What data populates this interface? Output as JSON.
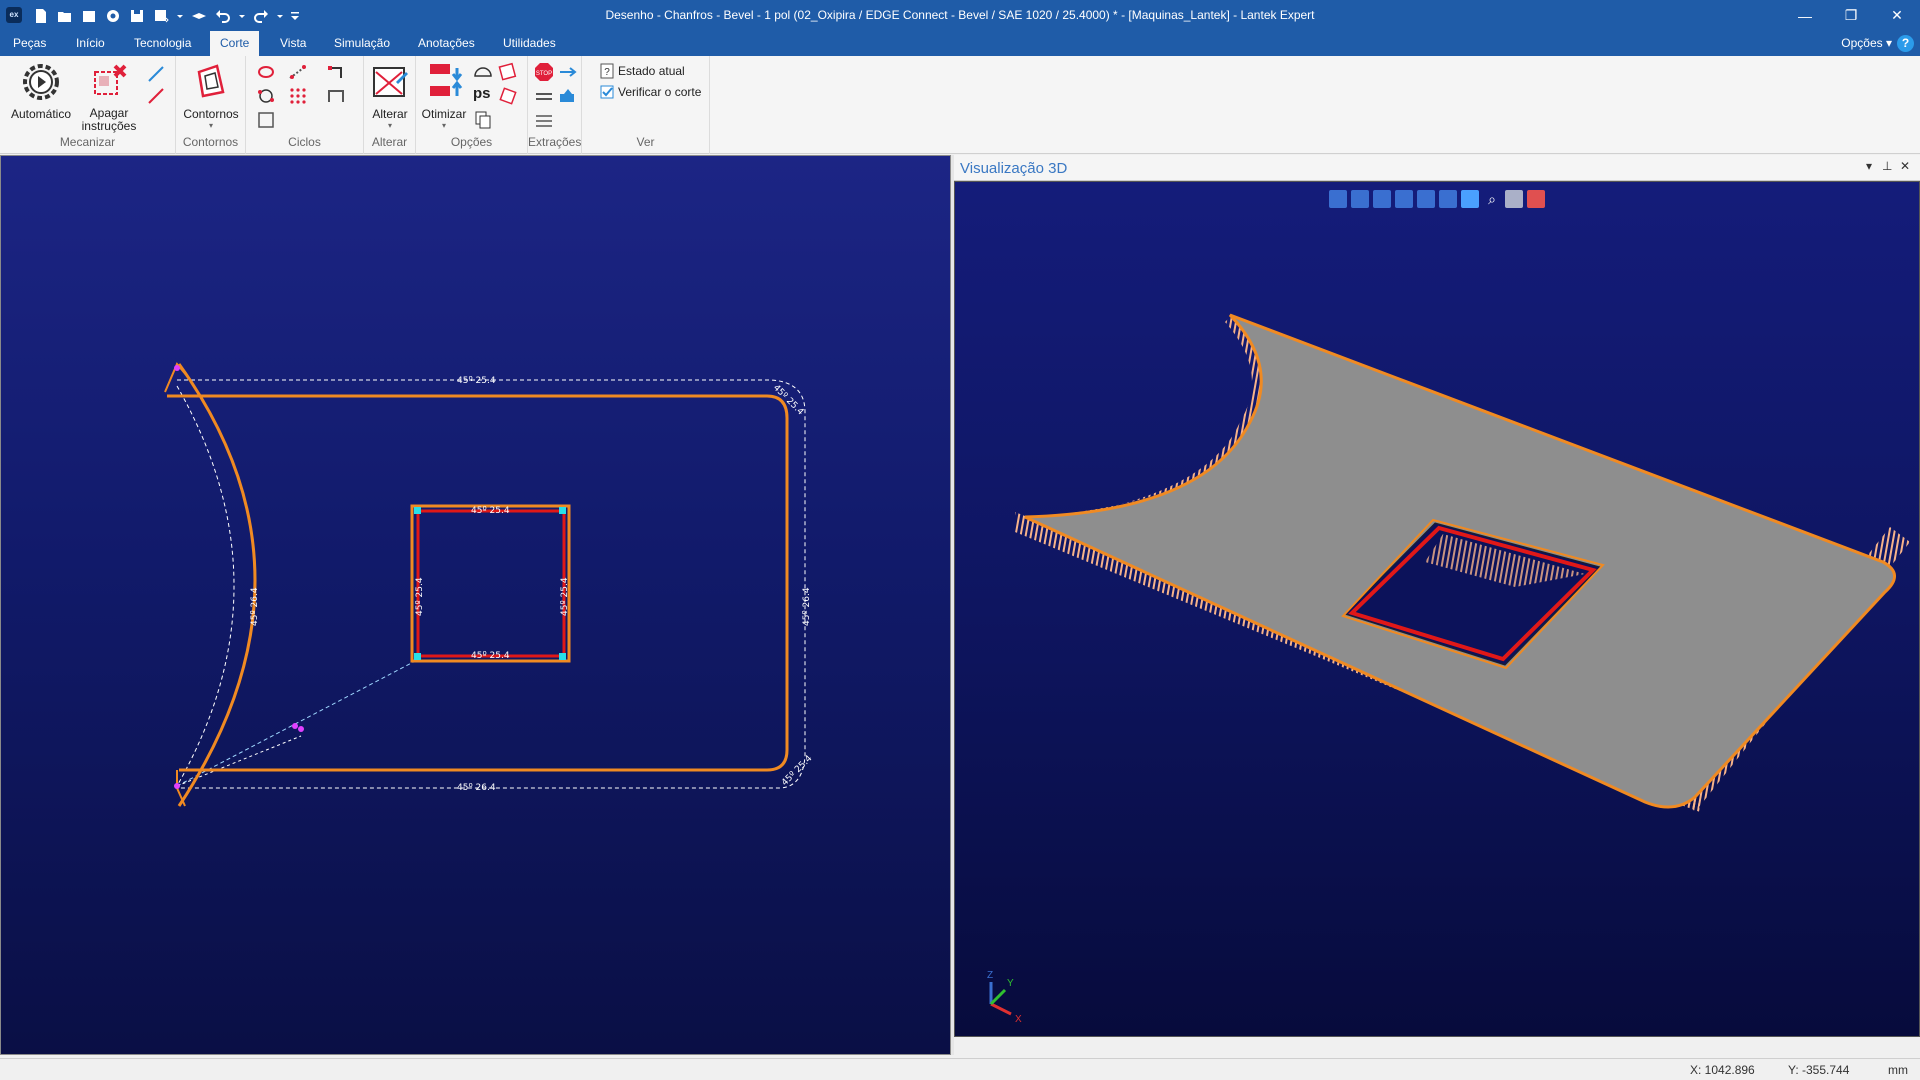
{
  "window": {
    "title": "Desenho - Chanfros - Bevel - 1 pol  (02_Oxipira / EDGE Connect - Bevel / SAE 1020 / 25.4000) * - [Maquinas_Lantek] - Lantek Expert",
    "app_icon_text": "ex",
    "controls": {
      "minimize": "—",
      "restore": "❐",
      "close": "✕"
    }
  },
  "ribbon_tabs": [
    "Peças",
    "Início",
    "Tecnologia",
    "Corte",
    "Vista",
    "Simulação",
    "Anotações",
    "Utilidades"
  ],
  "active_tab": "Corte",
  "options_label": "Opções",
  "help_label": "?",
  "ribbon": {
    "mecanizar": {
      "label": "Mecanizar",
      "automatico": "Automático",
      "apagar_1": "Apagar",
      "apagar_2": "instruções"
    },
    "contornos": {
      "label": "Contornos",
      "button": "Contornos"
    },
    "ciclos": {
      "label": "Ciclos"
    },
    "alterar": {
      "label": "Alterar",
      "button": "Alterar"
    },
    "opcoes": {
      "label": "Opções",
      "button": "Otimizar",
      "ps": "ps"
    },
    "extracoes": {
      "label": "Extrações"
    },
    "ver": {
      "label": "Ver",
      "estado_atual": "Estado atual",
      "verificar": "Verificar o corte"
    }
  },
  "drawing_labels": {
    "top": "45º 25.4",
    "bottom": "45º 26.4",
    "left_arc": "45º 26.4",
    "right_edge": "45º 26.4",
    "top_right_corner": "45º 25.4",
    "bottom_right_corner": "45º 25.4",
    "inner_top": "45º 25.4",
    "inner_bottom": "45º 25.4",
    "inner_left": "45º 25.4",
    "inner_right": "45º 25.4"
  },
  "panel3d": {
    "title": "Visualização 3D",
    "controls": {
      "dropdown": "▾",
      "pin": "⊥",
      "close": "✕"
    },
    "axes": {
      "x": "X",
      "y": "Y",
      "z": "Z"
    }
  },
  "status": {
    "x": "X: 1042.896",
    "y": "Y: -355.744",
    "unit": "mm"
  },
  "colors": {
    "title_bar": "#1f5ca8",
    "contour": "#f08a22",
    "inner_contour": "#e01818",
    "plate": "#8e8e8e"
  }
}
